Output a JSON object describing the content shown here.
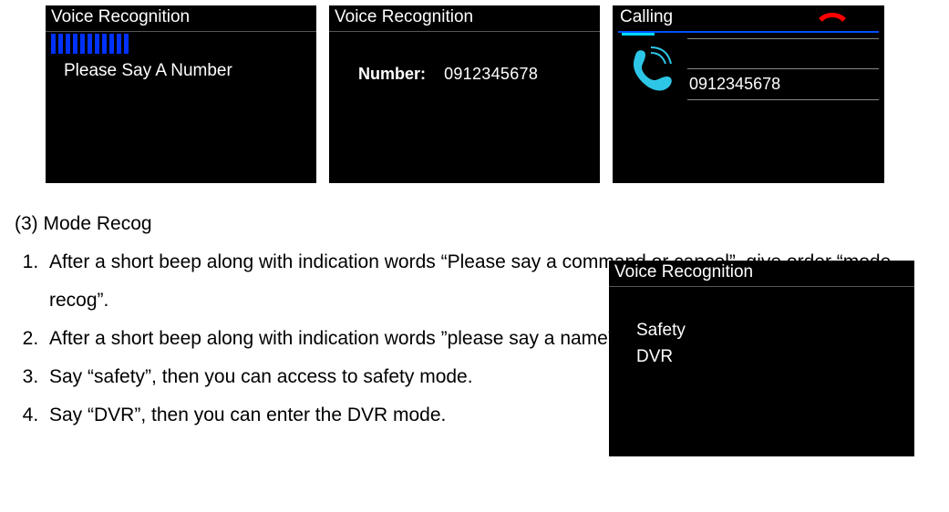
{
  "screens": {
    "vr_title": "Voice Recognition",
    "s1_prompt": "Please Say A Number",
    "s2_label": "Number:",
    "s2_value": "0912345678",
    "s3_title": "Calling",
    "s3_number": "0912345678",
    "s4_option1": "Safety",
    "s4_option2": "DVR"
  },
  "doc": {
    "section": "(3) Mode Recog",
    "steps": [
      "After a short beep along with indication words “Please say a command or cancel”, give order “mode recog”.",
      "After a short beep along with indication words ”please say a name”, give your order or cancel.",
      "Say “safety”, then you can access to safety mode.",
      "Say “DVR”, then you can enter the DVR mode."
    ]
  }
}
